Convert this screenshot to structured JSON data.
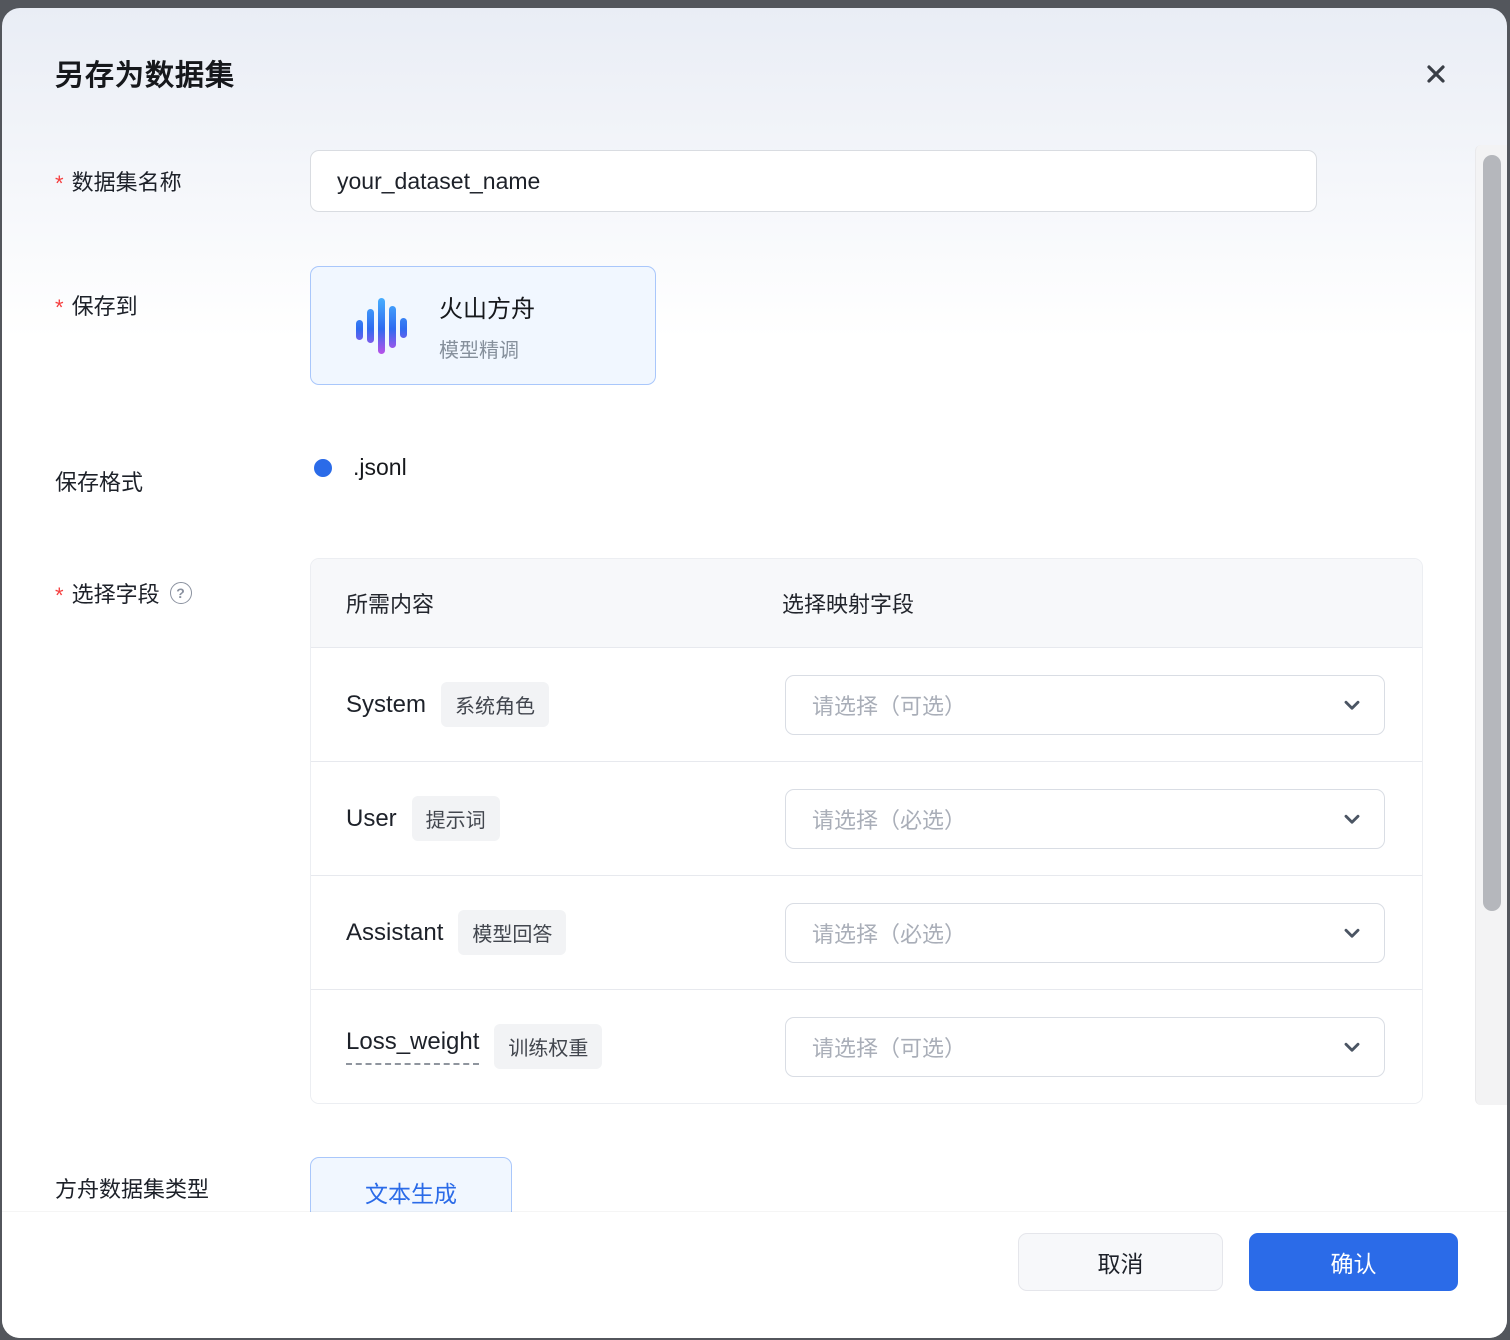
{
  "dialog": {
    "title": "另存为数据集"
  },
  "form": {
    "dataset_name": {
      "label": "数据集名称",
      "required": true,
      "value": "your_dataset_name"
    },
    "save_to": {
      "label": "保存到",
      "required": true,
      "provider": "火山方舟",
      "provider_desc": "模型精调"
    },
    "save_format": {
      "label": "保存格式",
      "selected_option": ".jsonl"
    },
    "select_fields": {
      "label": "选择字段",
      "required": true,
      "columns": [
        "所需内容",
        "选择映射字段"
      ],
      "rows": [
        {
          "name": "System",
          "badge": "系统角色",
          "placeholder": "请选择（可选）"
        },
        {
          "name": "User",
          "badge": "提示词",
          "placeholder": "请选择（必选）"
        },
        {
          "name": "Assistant",
          "badge": "模型回答",
          "placeholder": "请选择（必选）"
        },
        {
          "name": "Loss_weight",
          "badge": "训练权重",
          "placeholder": "请选择（可选）"
        }
      ]
    },
    "ark_dataset_type": {
      "label": "方舟数据集类型",
      "selected_option": "文本生成"
    }
  },
  "icons": {
    "help_glyph": "?"
  },
  "footer": {
    "cancel_label": "取消",
    "confirm_label": "确认"
  },
  "colors": {
    "primary": "#2b6be8",
    "danger": "#f53f3f",
    "card-bg": "#f1f7ff",
    "card-border": "#a9c7fb",
    "text-dark": "#1d2129",
    "text-gray": "#86909c",
    "ph-gray": "#a9aeb8"
  }
}
